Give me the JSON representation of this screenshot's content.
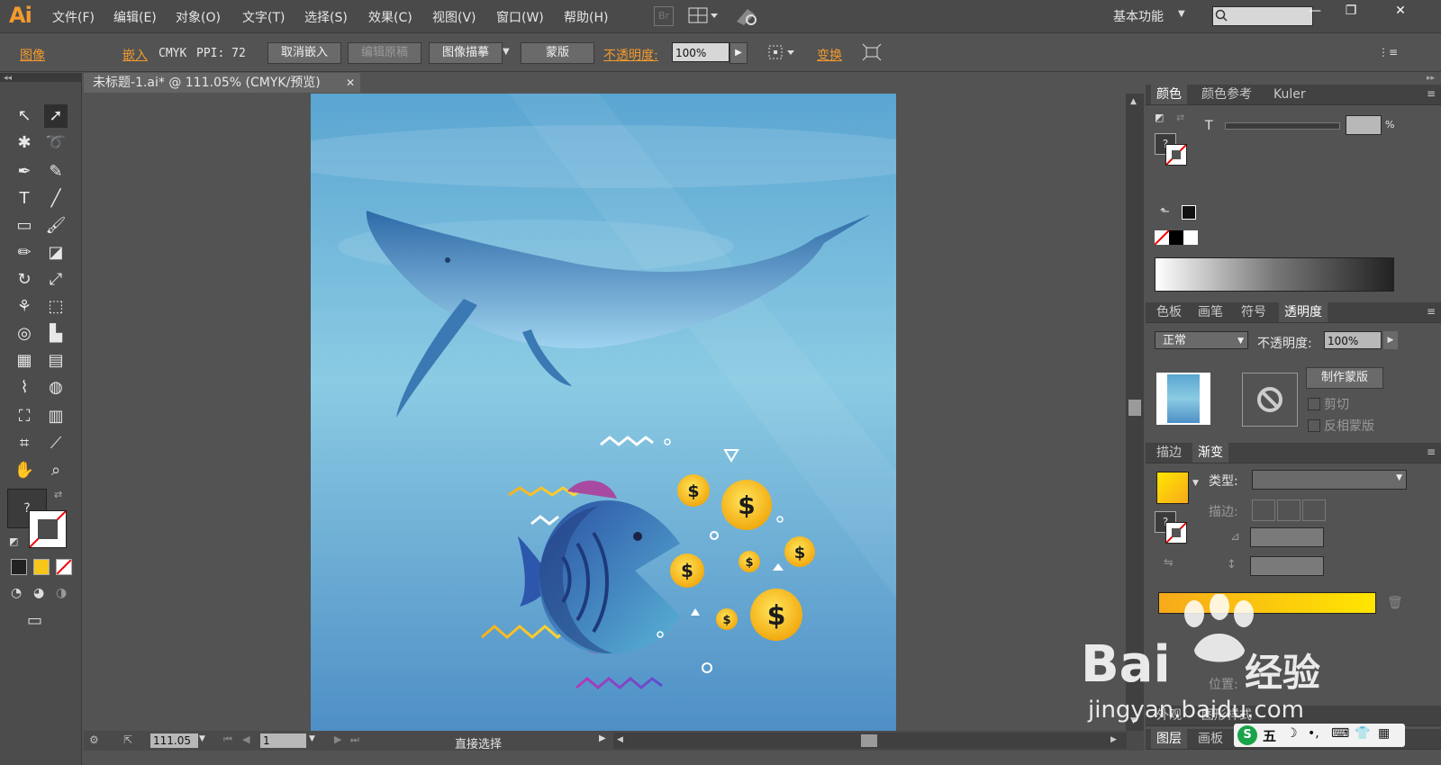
{
  "app": {
    "logo": "Ai",
    "workspace": "基本功能",
    "bridge_label": "Br"
  },
  "menu": [
    "文件(F)",
    "编辑(E)",
    "对象(O)",
    "文字(T)",
    "选择(S)",
    "效果(C)",
    "视图(V)",
    "窗口(W)",
    "帮助(H)"
  ],
  "control": {
    "image_label": "图像",
    "embed_label": "嵌入",
    "color_mode": "CMYK",
    "ppi": "PPI: 72",
    "unembed": "取消嵌入",
    "edit_original": "编辑原稿",
    "image_trace": "图像描摹",
    "mask": "蒙版",
    "opacity_label": "不透明度:",
    "opacity_value": "100%",
    "transform_label": "变换"
  },
  "document": {
    "tab_title": "未标题-1.ai* @ 111.05% (CMYK/预览)"
  },
  "status": {
    "zoom": "111.05",
    "artboard": "1",
    "tool": "直接选择"
  },
  "panels": {
    "color_tabs": [
      "颜色",
      "颜色参考",
      "Kuler"
    ],
    "color_t_label": "T",
    "color_percent": "%",
    "transparency_tabs": [
      "色板",
      "画笔",
      "符号",
      "透明度"
    ],
    "blend_mode": "正常",
    "opacity_label": "不透明度:",
    "opacity_value": "100%",
    "make_mask": "制作蒙版",
    "clip": "剪切",
    "invert_mask": "反相蒙版",
    "gradient_tabs": [
      "描边",
      "渐变"
    ],
    "type_label": "类型:",
    "stroke_label": "描边:",
    "position_label": "位置:",
    "bottom_tabs": [
      "外观",
      "图形样式"
    ],
    "layers_tabs": [
      "图层",
      "画板"
    ]
  },
  "watermark": {
    "brand": "Bai",
    "brand2": "经验",
    "url": "jingyan.baidu.com"
  },
  "ime": {
    "label": "五"
  },
  "colors": {
    "accent": "#f29a2e",
    "gradient_start": "#f7a91b",
    "gradient_end": "#ffe600"
  },
  "icons": [
    "selection-icon",
    "direct-selection-icon",
    "magic-wand-icon",
    "lasso-icon",
    "pen-icon",
    "curvature-icon",
    "type-icon",
    "line-icon",
    "rectangle-icon",
    "paintbrush-icon",
    "pencil-icon",
    "eraser-icon",
    "rotate-icon",
    "scale-icon",
    "warp-icon",
    "free-transform-icon",
    "shape-builder-icon",
    "chart-icon",
    "mesh-icon",
    "gradient-icon",
    "eyedropper-icon",
    "blend-icon",
    "symbol-sprayer-icon",
    "column-graph-icon",
    "artboard-icon",
    "slice-icon",
    "hand-icon",
    "zoom-icon"
  ]
}
